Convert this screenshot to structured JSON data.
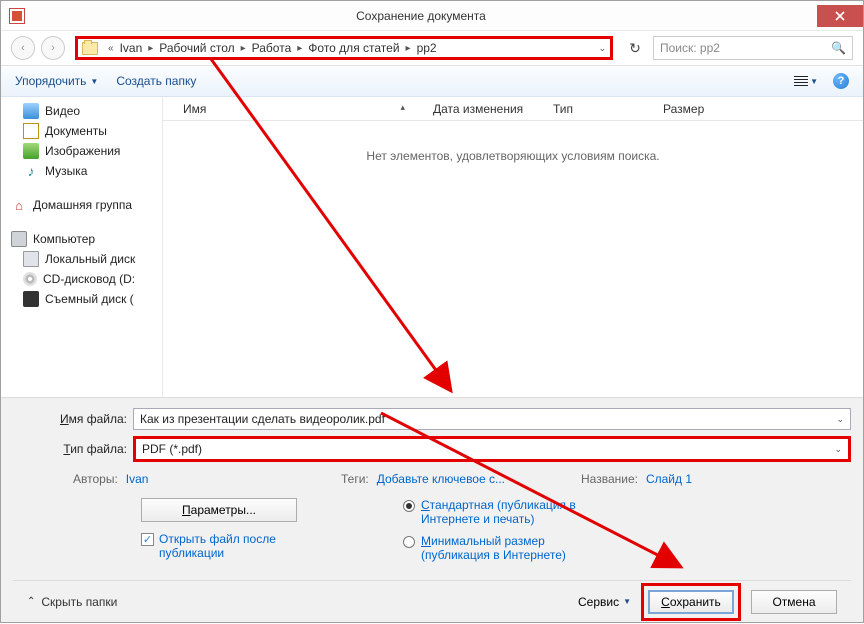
{
  "window": {
    "title": "Сохранение документа"
  },
  "nav": {
    "back": "‹",
    "fwd": "›",
    "crumbs": [
      "Ivan",
      "Рабочий стол",
      "Работа",
      "Фото для статей",
      "pp2"
    ],
    "refresh": "↻",
    "search_placeholder": "Поиск: pp2",
    "search_icon": "🔍"
  },
  "toolbar": {
    "organize": "Упорядочить",
    "newfolder": "Создать папку"
  },
  "sidebar": {
    "video": "Видео",
    "documents": "Документы",
    "images": "Изображения",
    "music": "Музыка",
    "homegroup": "Домашняя группа",
    "computer": "Компьютер",
    "localdisk": "Локальный диск",
    "cdrom": "CD-дисковод (D:",
    "usb": "Съемный диск ("
  },
  "columns": {
    "name": "Имя",
    "date": "Дата изменения",
    "type": "Тип",
    "size": "Размер"
  },
  "main": {
    "empty": "Нет элементов, удовлетворяющих условиям поиска."
  },
  "fields": {
    "filename_label_u": "И",
    "filename_label_r": "мя файла:",
    "filename_value": "Как из презентации сделать видеоролик.pdf",
    "filetype_label_u": "Т",
    "filetype_label_r": "ип файла:",
    "filetype_value": "PDF (*.pdf)"
  },
  "meta": {
    "authors_label": "Авторы:",
    "authors_value": "Ivan",
    "tags_label": "Теги:",
    "tags_value": "Добавьте ключевое с...",
    "title_label": "Название:",
    "title_value": "Слайд 1"
  },
  "options": {
    "params_u": "П",
    "params_r": "араметры...",
    "open_after": "Открыть файл после публикации",
    "standard_u": "С",
    "standard_r": "тандартная (публикация в Интернете и печать)",
    "minimal_u": "М",
    "minimal_r": "инимальный размер (публикация в Интернете)"
  },
  "footer": {
    "hide": "Скрыть папки",
    "service": "Сервис",
    "save_u": "С",
    "save_r": "охранить",
    "cancel": "Отмена"
  }
}
